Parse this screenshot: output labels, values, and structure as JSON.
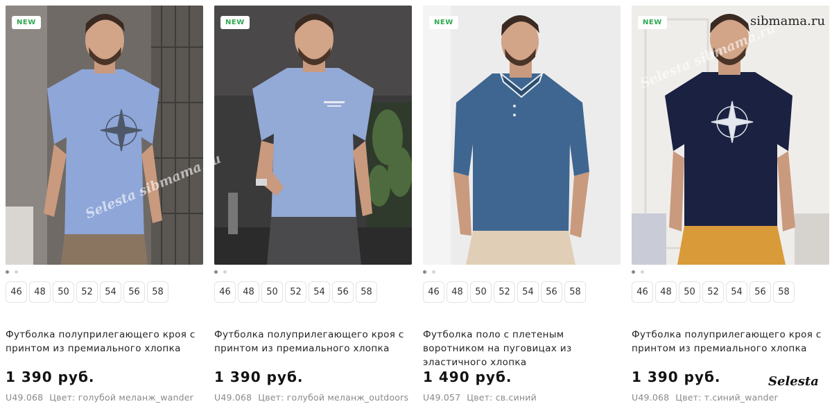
{
  "watermarks": {
    "site": "sibmama.ru",
    "brand": "Selesta",
    "overlay": "Selesta sibmama.ru"
  },
  "colors": {
    "badge_text": "#2fa84f",
    "muted": "#8a8a8a"
  },
  "products": [
    {
      "badge": "NEW",
      "sizes": [
        "46",
        "48",
        "50",
        "52",
        "54",
        "56",
        "58"
      ],
      "title": "Футболка полуприлегающего кроя с принтом из премиального хлопка",
      "price": "1 390 руб.",
      "sku": "U49.068",
      "color_label": "Цвет: голубой меланж_wander",
      "image": {
        "shirt": "#8ea6d8",
        "pants": "#8a7560",
        "bg": "#6f6a66",
        "print": "compass"
      }
    },
    {
      "badge": "NEW",
      "sizes": [
        "46",
        "48",
        "50",
        "52",
        "54",
        "56",
        "58"
      ],
      "title": "Футболка полуприлегающего кроя с принтом из премиального хлопка",
      "price": "1 390 руб.",
      "sku": "U49.068",
      "color_label": "Цвет: голубой меланж_outdoors",
      "image": {
        "shirt": "#93a9d6",
        "pants": "#4a4a4c",
        "bg": "#3a3a3a",
        "print": "text"
      }
    },
    {
      "badge": "NEW",
      "sizes": [
        "46",
        "48",
        "50",
        "52",
        "54",
        "56",
        "58"
      ],
      "title": "Футболка поло с плетеным воротником на пуговицах из эластичного хлопка",
      "price": "1 490 руб.",
      "sku": "U49.057",
      "color_label": "Цвет: св.синий",
      "image": {
        "shirt": "#3f6690",
        "pants": "#e0cfb6",
        "bg": "#ececec",
        "print": "polo"
      }
    },
    {
      "badge": "NEW",
      "sizes": [
        "46",
        "48",
        "50",
        "52",
        "54",
        "56",
        "58"
      ],
      "title": "Футболка полуприлегающего кроя с принтом из премиального хлопка",
      "price": "1 390 руб.",
      "sku": "U49.068",
      "color_label": "Цвет: т.синий_wander",
      "image": {
        "shirt": "#1b2140",
        "pants": "#d99a3a",
        "bg": "#e9e7e4",
        "print": "compass-light"
      }
    }
  ]
}
